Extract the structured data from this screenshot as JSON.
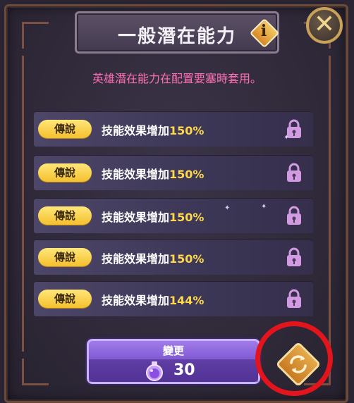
{
  "title": "一般潛在能力",
  "subtitle": "英雄潛在能力在配置要塞時套用。",
  "close_symbol": "✕",
  "info_symbol": "i",
  "rows": [
    {
      "grade": "傳說",
      "effect": "技能效果增加",
      "value": "150%"
    },
    {
      "grade": "傳說",
      "effect": "技能效果增加",
      "value": "150%"
    },
    {
      "grade": "傳說",
      "effect": "技能效果增加",
      "value": "150%"
    },
    {
      "grade": "傳說",
      "effect": "技能效果增加",
      "value": "150%"
    },
    {
      "grade": "傳說",
      "effect": "技能效果增加",
      "value": "144%"
    }
  ],
  "change_button": {
    "label": "變更",
    "cost": "30"
  },
  "icons": {
    "close": "close-icon",
    "info": "info-icon",
    "lock": "lock-icon",
    "potion": "potion-icon",
    "refresh": "refresh-icon"
  },
  "colors": {
    "grade_badge": "#f5c02d",
    "value_text": "#ffd84a",
    "subtitle_text": "#ff6fb5",
    "lock": "#d29ae0",
    "change_button": "#7a52cf",
    "highlight_ring": "#e3141b"
  }
}
